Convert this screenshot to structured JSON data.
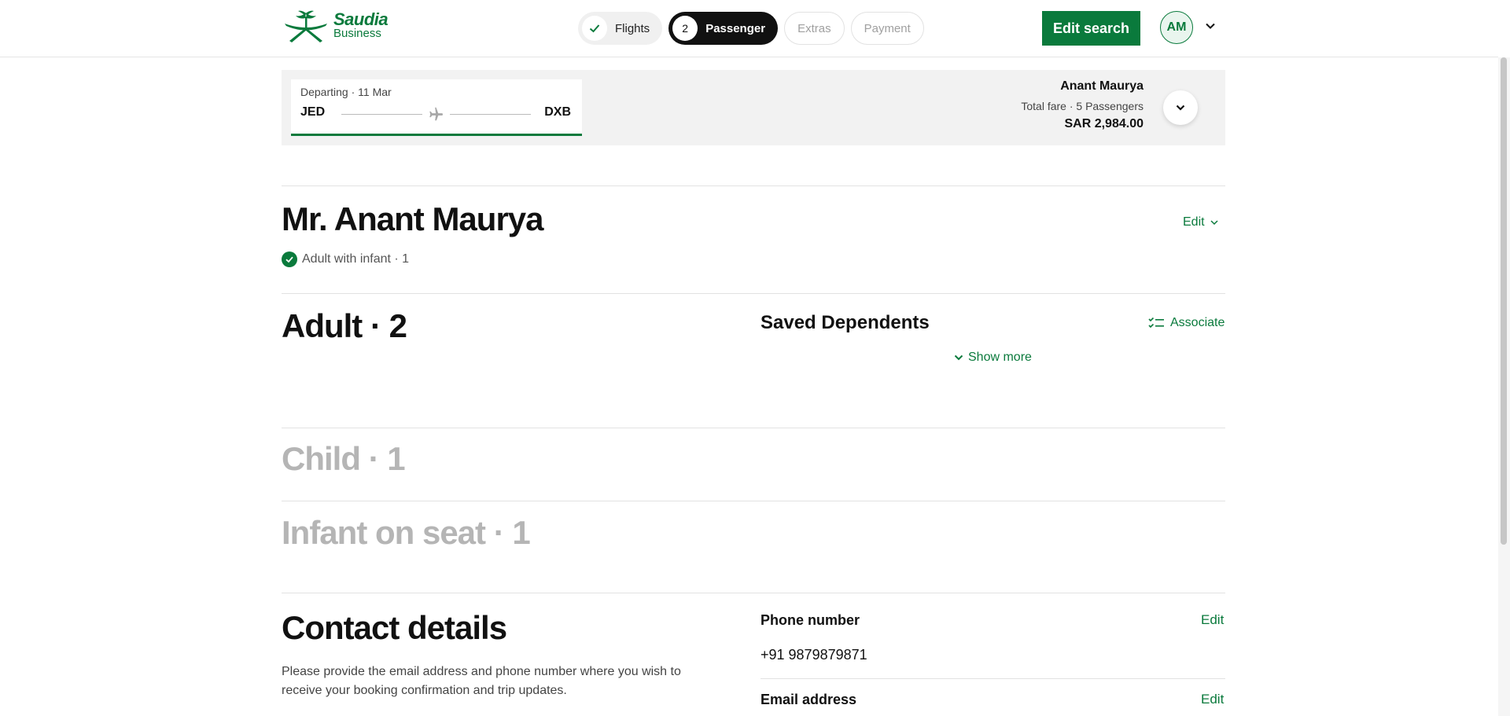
{
  "brand": {
    "line1": "Saudia",
    "line2": "Business",
    "color": "#0a7a3c"
  },
  "steps": [
    {
      "label": "Flights",
      "state": "done",
      "marker": "check-icon"
    },
    {
      "label": "Passenger",
      "state": "active",
      "marker": "2"
    },
    {
      "label": "Extras",
      "state": "future"
    },
    {
      "label": "Payment",
      "state": "future"
    }
  ],
  "header": {
    "edit_search_label": "Edit search",
    "avatar_initials": "AM"
  },
  "summary": {
    "departing": "Departing · 11 Mar",
    "from": "JED",
    "to": "DXB",
    "passenger_name": "Anant Maurya",
    "fare_label": "Total fare · 5 Passengers",
    "fare_amount": "SAR 2,984.00"
  },
  "lead": {
    "name": "Mr. Anant Maurya",
    "status": "Adult with infant · 1",
    "edit_label": "Edit"
  },
  "sections": {
    "adult": "Adult · 2",
    "saved_dependents": "Saved Dependents",
    "associate": "Associate",
    "show_more": "Show more",
    "child": "Child · 1",
    "infant": "Infant on seat · 1"
  },
  "contact": {
    "title": "Contact details",
    "description": "Please provide the email address and phone number where you wish to receive your booking confirmation and trip updates.",
    "phone_label": "Phone number",
    "phone_value": "+91 9879879871",
    "email_label": "Email address",
    "edit_label": "Edit"
  }
}
